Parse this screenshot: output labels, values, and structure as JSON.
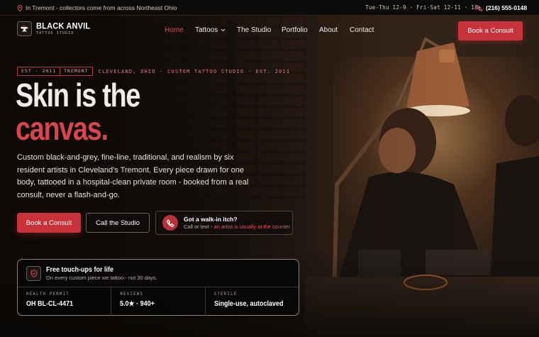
{
  "topbar": {
    "location": "In Tremont - collectors come from across Northeast Ohio",
    "hours": "Tue-Thu 12-9 · Fri-Sat 12-11 · 18+",
    "phone": "(216) 555-0148"
  },
  "brand": {
    "name": "BLACK ANVIL",
    "tagline": "TATTOO STUDIO",
    "accent": "#c8323a"
  },
  "nav": {
    "items": [
      {
        "label": "Home",
        "active": true
      },
      {
        "label": "Tattoos",
        "has_dropdown": true
      },
      {
        "label": "The Studio"
      },
      {
        "label": "Portfolio"
      },
      {
        "label": "About"
      },
      {
        "label": "Contact"
      }
    ],
    "cta": "Book a Consult"
  },
  "hero": {
    "tag_left": "EST · 2011",
    "tag_right": "TREMONT",
    "eyebrow": "CLEVELAND, OHIO · CUSTOM TATTOO STUDIO · EST. 2011",
    "headline_line1": "Skin is the",
    "headline_line2": "canvas.",
    "lead": "Custom black-and-grey, fine-line, traditional, and realism by six resident artists in Cleveland's Tremont. Every piece drawn for one body, tattooed in a hospital-clean private room - booked from a real consult, never a flash-and-go.",
    "primary_cta": "Book a Consult",
    "secondary_cta": "Call the Studio",
    "walkin_title": "Got a walk-in itch?",
    "walkin_text": "Call or text - ",
    "walkin_highlight": "an artist is usually at the counter"
  },
  "card": {
    "title": "Free touch-ups for life",
    "subtitle": "On every custom piece we tattoo - not 30 days.",
    "stats": [
      {
        "label": "HEALTH PERMIT",
        "value": "OH BL-CL-4471"
      },
      {
        "label": "REVIEWS",
        "value": "5.0★ · 940+"
      },
      {
        "label": "STERILE",
        "value": "Single-use, autoclaved"
      }
    ]
  },
  "icons": {
    "location": "map-pin-icon",
    "phone": "phone-icon",
    "logo": "anvil-logo-icon",
    "dropdown": "chevron-down-icon",
    "shield": "shield-icon"
  }
}
